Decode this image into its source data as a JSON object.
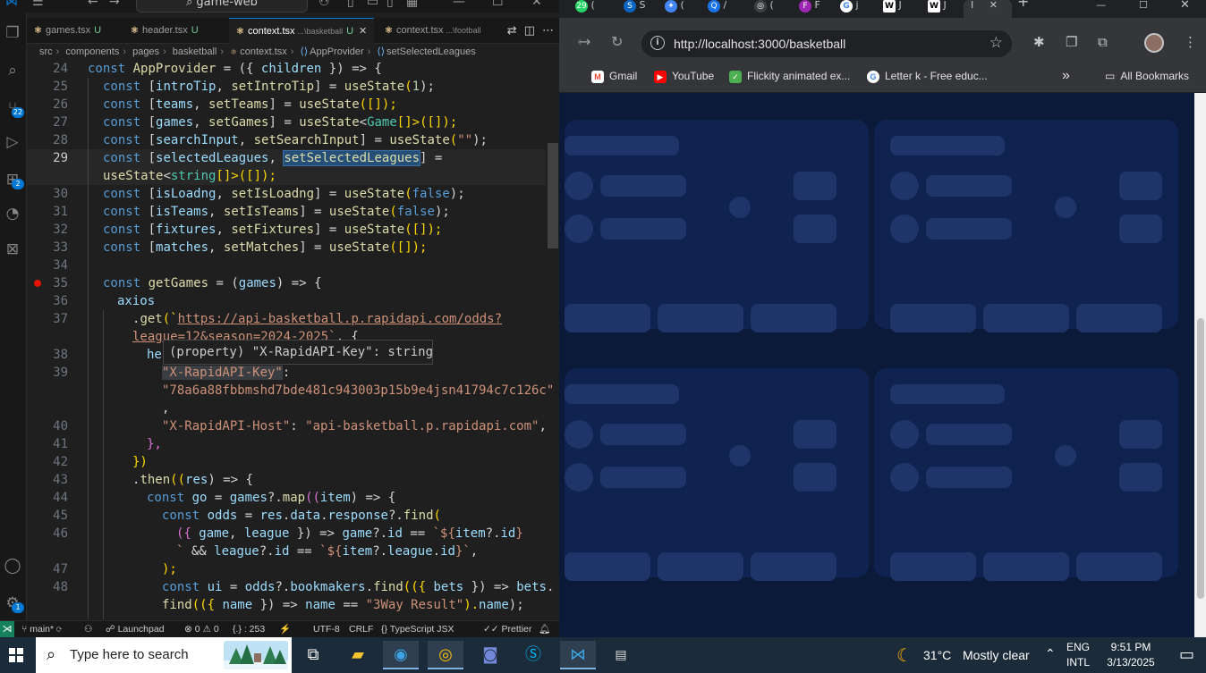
{
  "vscode": {
    "title_search": "game-web",
    "tabs": [
      {
        "name": "games.tsx",
        "badge": "U",
        "dir": ""
      },
      {
        "name": "header.tsx",
        "badge": "U",
        "dir": ""
      },
      {
        "name": "context.tsx",
        "badge": "U",
        "dir": "...\\basketball"
      },
      {
        "name": "context.tsx",
        "badge": "",
        "dir": "...\\football"
      }
    ],
    "breadcrumb": [
      "src",
      "components",
      "pages",
      "basketball",
      "context.tsx",
      "AppProvider",
      "setSelectedLeagues"
    ],
    "line_numbers": [
      "24",
      "25",
      "26",
      "27",
      "28",
      "29",
      "",
      "30",
      "31",
      "32",
      "33",
      "34",
      "35",
      "36",
      "37",
      "",
      "38",
      "39",
      "",
      "",
      "40",
      "41",
      "42",
      "43",
      "44",
      "45",
      "46",
      "",
      "47",
      "48",
      ""
    ],
    "hover_text": "(property) \"X-RapidAPI-Key\": string",
    "code": {
      "l24": [
        "const",
        "AppProvider",
        "= ({",
        "children",
        "}) => {"
      ],
      "l25": [
        "const [",
        "introTip",
        ", ",
        "setIntroTip",
        "] = ",
        "useState",
        "(",
        "1",
        ");"
      ],
      "l26": [
        "const [",
        "teams",
        ", ",
        "setTeams",
        "] = ",
        "useState",
        "([]);"
      ],
      "l27": [
        "const [",
        "games",
        ", ",
        "setGames",
        "] = ",
        "useState",
        "<",
        "Game",
        "[]>([]);"
      ],
      "l28": [
        "const [",
        "searchInput",
        ", ",
        "setSearchInput",
        "] = ",
        "useState",
        "(",
        "\"\"",
        ");"
      ],
      "l29a": [
        "const [",
        "selectedLeagues",
        ", ",
        "setSelectedLeagues",
        "] ="
      ],
      "l29b": [
        "useState",
        "<",
        "string",
        "[]>([]);"
      ],
      "l30": [
        "const [",
        "isLoadng",
        ", ",
        "setIsLoadng",
        "] = ",
        "useState",
        "(",
        "false",
        ");"
      ],
      "l31": [
        "const [",
        "isTeams",
        ", ",
        "setIsTeams",
        "] = ",
        "useState",
        "(",
        "false",
        ");"
      ],
      "l32": [
        "const [",
        "fixtures",
        ", ",
        "setFixtures",
        "] = ",
        "useState",
        "([]);"
      ],
      "l33": [
        "const [",
        "matches",
        ", ",
        "setMatches",
        "] = ",
        "useState",
        "([]);"
      ],
      "l35": [
        "const",
        "getGames",
        "= (",
        "games",
        ") => {"
      ],
      "l36": [
        "axios"
      ],
      "l37a": [
        ".",
        "get",
        "(`",
        "https://api-basketball.p.rapidapi.com/odds?"
      ],
      "l37b": [
        "league=12&season=2024-2025`",
        ", {"
      ],
      "l38": [
        "he"
      ],
      "l39a": [
        "\"X-RapidAPI-Key\"",
        ":"
      ],
      "l39b": [
        "\"78a6a88fbbmshd7bde481c943003p15b9e4jsn41794c7c126c\""
      ],
      "l39c": [
        ","
      ],
      "l40": [
        "\"X-RapidAPI-Host\"",
        ": ",
        "\"api-basketball.p.rapidapi.com\"",
        ","
      ],
      "l41": [
        "},"
      ],
      "l42": [
        "})"
      ],
      "l43": [
        ".",
        "then",
        "((",
        "res",
        ") => {"
      ],
      "l44": [
        "const",
        "go",
        "= ",
        "games",
        "?.",
        "map",
        "((",
        "item",
        ") => {"
      ],
      "l45": [
        "const",
        "odds",
        "= ",
        "res",
        ".",
        "data",
        ".",
        "response",
        "?.",
        "find",
        "("
      ],
      "l46a": [
        "({ ",
        "game",
        ", ",
        "league",
        " }) => ",
        "game",
        "?.",
        "id",
        " == ",
        "`${",
        "item",
        "?.",
        "id",
        "}"
      ],
      "l46b": [
        "`",
        " && ",
        "league",
        "?.",
        "id",
        " == ",
        "`${",
        "item",
        "?.",
        "league",
        ".",
        "id",
        "}`",
        ","
      ],
      "l47": [
        ");"
      ],
      "l48a": [
        "const",
        "ui",
        "= ",
        "odds",
        "?.",
        "bookmakers",
        ".",
        "find",
        "(({ ",
        "bets",
        " }) => ",
        "bets",
        "."
      ],
      "l48b": [
        "find",
        "(({ ",
        "name",
        " }) => ",
        "name",
        " == ",
        "\"3Way Result\"",
        ").",
        "name",
        ");"
      ]
    },
    "status": {
      "branch": "main*",
      "launchpad": "Launchpad",
      "errors": "0",
      "warnings": "0",
      "selection": "{.} : 253",
      "encoding": "UTF-8",
      "eol": "CRLF",
      "language": "TypeScript JSX",
      "formatter": "Prettier"
    },
    "activity_badges": {
      "scm": "22",
      "extensions": "2",
      "accounts": "1"
    }
  },
  "chrome": {
    "url": "http://localhost:3000/basketball",
    "tabs": [
      {
        "icon": "29",
        "label": "(",
        "color": "#25d366"
      },
      {
        "icon": "S",
        "label": "S",
        "color": "#0a66c2"
      },
      {
        "icon": "✦",
        "label": "(",
        "color": "#4285f4"
      },
      {
        "icon": "Q",
        "label": "/",
        "color": "#1a73e8"
      },
      {
        "icon": "◎",
        "label": "(",
        "color": "#3c4043"
      },
      {
        "icon": "F",
        "label": "F",
        "color": "#9c27b0"
      },
      {
        "icon": "G",
        "label": "j",
        "color": "#ffffff"
      },
      {
        "icon": "W",
        "label": "J",
        "color": "#ffffff"
      },
      {
        "icon": "W",
        "label": "J",
        "color": "#ffffff"
      },
      {
        "icon": "",
        "label": "I",
        "color": "#202124"
      }
    ],
    "bookmarks": [
      {
        "label": "Gmail",
        "color": "#ea4335",
        "icon": "M"
      },
      {
        "label": "YouTube",
        "color": "#ff0000",
        "icon": "▶"
      },
      {
        "label": "Flickity animated ex...",
        "color": "#4caf50",
        "icon": "✓"
      },
      {
        "label": "Letter k - Free educ...",
        "color": "#4285f4",
        "icon": "G"
      }
    ],
    "all_bookmarks": "All Bookmarks",
    "more": "»"
  },
  "taskbar": {
    "search_placeholder": "Type here to search",
    "weather": "31°C",
    "weather_text": "Mostly clear",
    "lang1": "ENG",
    "lang2": "INTL",
    "time": "9:51 PM",
    "date": "3/13/2025"
  }
}
